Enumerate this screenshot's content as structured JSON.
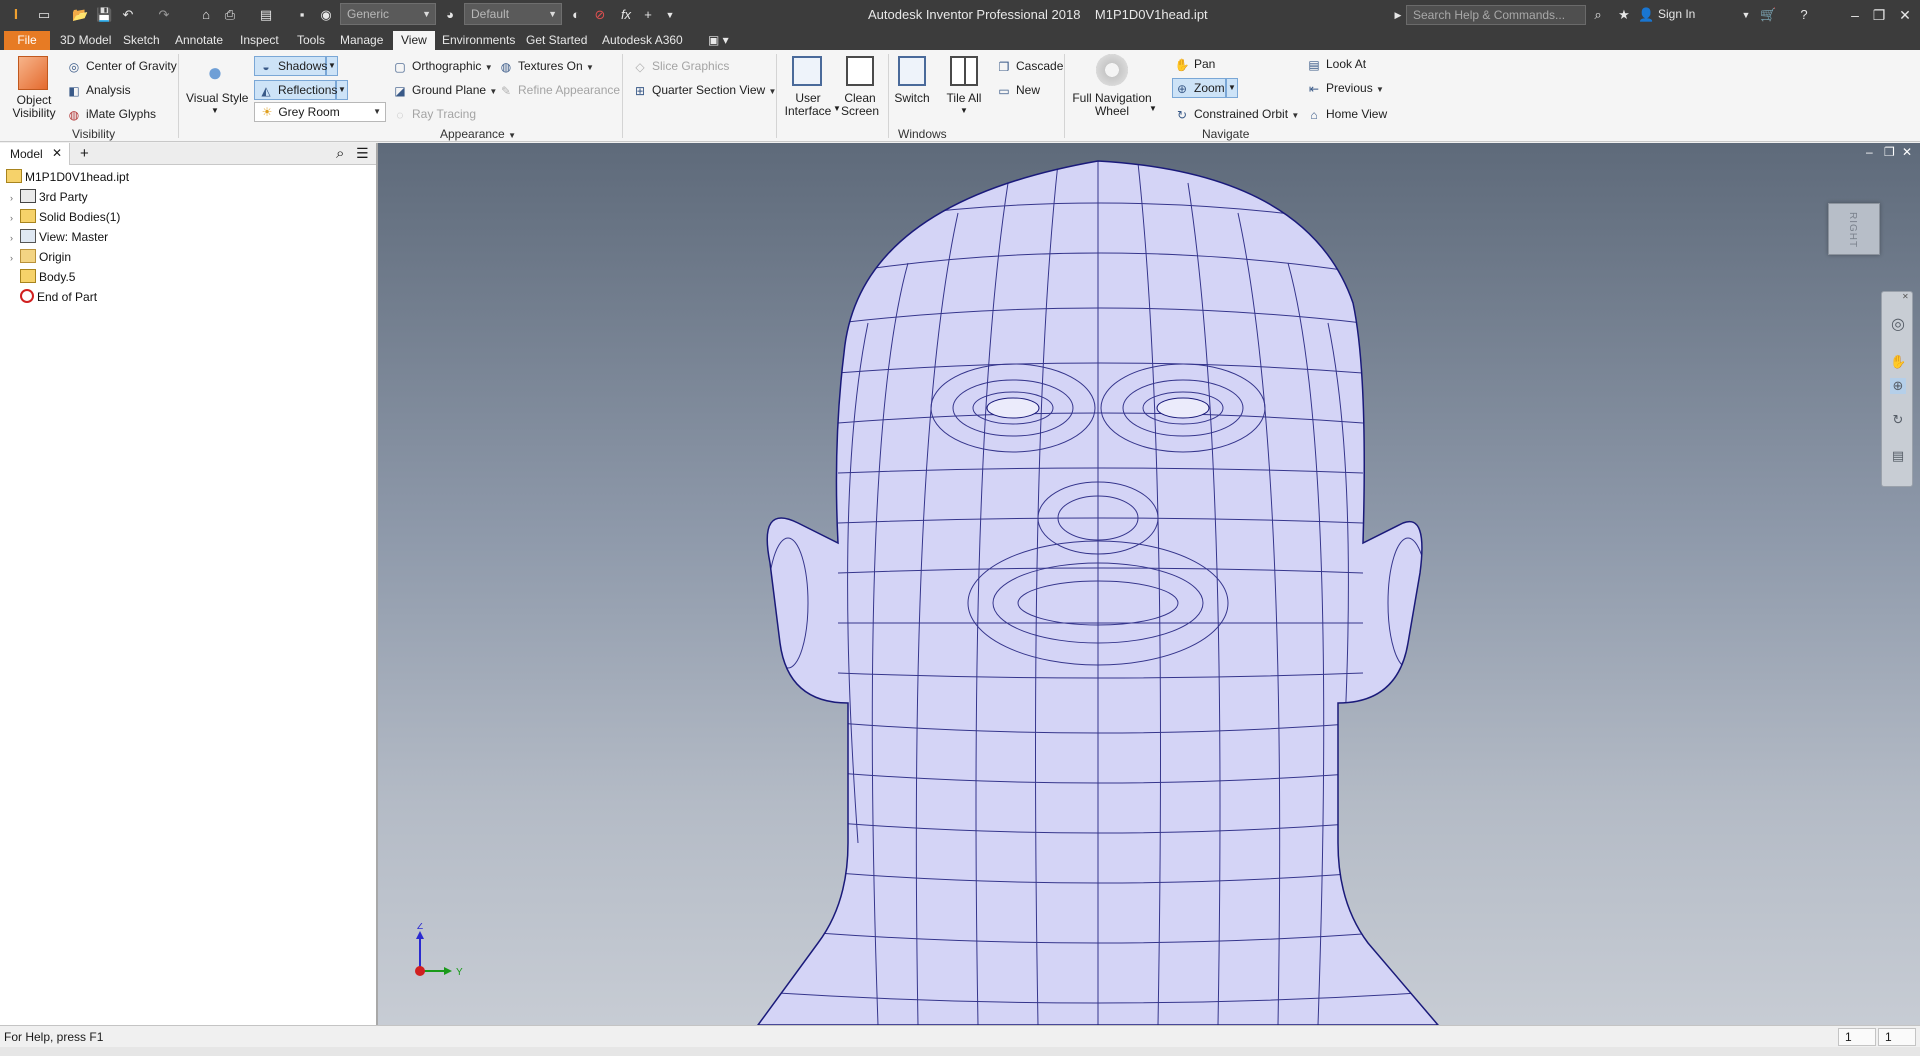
{
  "titlebar": {
    "app_title": "Autodesk Inventor Professional 2018    M1P1D0V1head.ipt",
    "material_dropdown": "Generic",
    "appearance_dropdown": "Default",
    "search_placeholder": "Search Help & Commands...",
    "signin_label": "Sign In"
  },
  "tabs": [
    "File",
    "3D Model",
    "Sketch",
    "Annotate",
    "Inspect",
    "Tools",
    "Manage",
    "View",
    "Environments",
    "Get Started",
    "Autodesk A360"
  ],
  "active_tab": "View",
  "ribbon": {
    "visibility": {
      "panel_label": "Visibility",
      "object_visibility": "Object\nVisibility",
      "center_of_gravity": "Center of Gravity",
      "analysis": "Analysis",
      "imate_glyphs": "iMate Glyphs"
    },
    "appearance": {
      "panel_label": "Appearance",
      "visual_style": "Visual Style",
      "shadows": "Shadows",
      "reflections": "Reflections",
      "lighting_style": "Grey Room",
      "orthographic": "Orthographic",
      "ground_plane": "Ground Plane",
      "ray_tracing": "Ray Tracing",
      "textures_on": "Textures On",
      "refine_appearance": "Refine Appearance",
      "slice_graphics": "Slice Graphics",
      "quarter_section_view": "Quarter Section View"
    },
    "windows": {
      "panel_label": "Windows",
      "user_interface": "User\nInterface",
      "clean_screen": "Clean\nScreen",
      "switch": "Switch",
      "tile_all": "Tile All",
      "cascade": "Cascade",
      "new": "New"
    },
    "navigate": {
      "panel_label": "Navigate",
      "full_navigation_wheel": "Full Navigation\nWheel",
      "pan": "Pan",
      "zoom": "Zoom",
      "constrained_orbit": "Constrained Orbit",
      "look_at": "Look At",
      "previous": "Previous",
      "home_view": "Home View"
    }
  },
  "browser": {
    "tab_label": "Model",
    "tree": [
      {
        "label": "M1P1D0V1head.ipt",
        "icon": "part-icon"
      },
      {
        "label": "3rd Party",
        "icon": "third-party-icon"
      },
      {
        "label": "Solid Bodies(1)",
        "icon": "solid-bodies-icon"
      },
      {
        "label": "View: Master",
        "icon": "view-icon"
      },
      {
        "label": "Origin",
        "icon": "folder-icon"
      },
      {
        "label": "Body.5",
        "icon": "body-icon"
      },
      {
        "label": "End of Part",
        "icon": "end-of-part-icon"
      }
    ]
  },
  "viewport": {
    "viewcube_face": "RIGHT",
    "triad_z": "Z",
    "triad_y": "Y",
    "mesh_color": "#d4d4f6",
    "mesh_line_color": "#1a1a7a"
  },
  "statusbar": {
    "help_text": "For Help, press F1",
    "field1": "1",
    "field2": "1"
  },
  "colors": {
    "file_tab": "#e77b24",
    "titlebar": "#3c3c3c",
    "highlight": "#cde3f7"
  }
}
